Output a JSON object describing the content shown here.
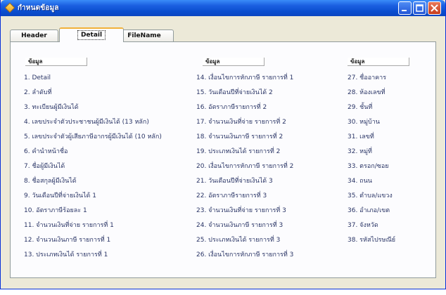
{
  "window": {
    "title": "กำหนดข้อมูล"
  },
  "tabs": [
    {
      "label": "Header"
    },
    {
      "label": "Detail"
    },
    {
      "label": "FileName"
    }
  ],
  "columns": {
    "header_label": "ข้อมูล",
    "col1": [
      "1. Detail",
      "2. ลำดับที่",
      "3. ทะเบียนผู้มีเงินได้",
      "4. เลขประจำตัวประชาชนผู้มีเงินได้ (13 หลัก)",
      "5. เลขประจำตัวผู้เสียภาษีอากรผู้มีเงินได้ (10 หลัก)",
      "6. คำนำหน้าชื่อ",
      "7. ชื่อผู้มีเงินได้",
      "8. ชื่อสกุลผู้มีเงินได้",
      "9. วันเดือนปีที่จ่ายเงินได้ 1",
      "10. อัตราภาษีร้อยละ 1",
      "11. จำนวนเงินที่จ่าย รายการที่ 1",
      "12. จำนวนเงินภาษี รายการที่ 1",
      "13. ประเภทเงินได้ รายการที่ 1"
    ],
    "col2": [
      "14. เงื่อนไขการหักภาษี รายการที่ 1",
      "15. วันเดือนปีที่จ่ายเงินได้ 2",
      "16. อัตราภาษีรายการที่ 2",
      "17. จำนวนเงินที่จ่าย รายการที่ 2",
      "18. จำนวนเงินภาษี รายการที่ 2",
      "19. ประเภทเงินได้ รายการที่ 2",
      "20. เงื่อนไขการหักภาษี รายการที่ 2",
      "21. วันเดือนปีที่จ่ายเงินได้ 3",
      "22. อัตราภาษีรายการที่ 3",
      "23. จำนวนเงินที่จ่าย รายการที่ 3",
      "24. จำนวนเงินภาษี รายการที่ 3",
      "25. ประเภทเงินได้ รายการที่ 3",
      "26. เงื่อนไขการหักภาษี รายการที่ 3"
    ],
    "col3": [
      "27. ชื่ออาคาร",
      "28. ห้องเลขที่",
      "29. ชั้นที่",
      "30. หมู่บ้าน",
      "31. เลขที่",
      "32. หมู่ที่",
      "33. ตรอก/ซอย",
      "34. ถนน",
      "35. ตำบล/แขวง",
      "36. อำเภอ/เขต",
      "37. จังหวัด",
      "38. รหัสไปรษณีย์"
    ]
  }
}
